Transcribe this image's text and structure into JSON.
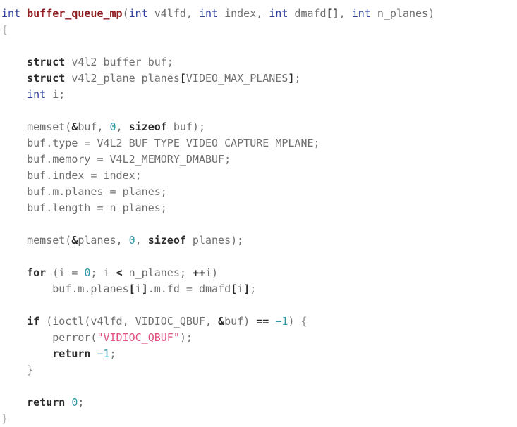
{
  "document": {
    "kind": "source-code-listing",
    "language": "c",
    "background": "#ffffff",
    "colors": {
      "plain": "#6f6f6f",
      "type_keyword": "#2f3f9e",
      "keyword": "#2b2b2b",
      "function_name": "#8f1d22",
      "number": "#2f97a6",
      "string": "#e0527f",
      "operator": "#2b2b2b",
      "brace": "#b0b0b0"
    }
  },
  "code": {
    "lines": [
      {
        "indent": 0,
        "tokens": [
          {
            "t": "int",
            "c": "t-type"
          },
          {
            "t": " ",
            "c": "t-plain"
          },
          {
            "t": "buffer_queue_mp",
            "c": "t-fn"
          },
          {
            "t": "(",
            "c": "t-plain"
          },
          {
            "t": "int",
            "c": "t-type"
          },
          {
            "t": " v4lfd, ",
            "c": "t-plain"
          },
          {
            "t": "int",
            "c": "t-type"
          },
          {
            "t": " index, ",
            "c": "t-plain"
          },
          {
            "t": "int",
            "c": "t-type"
          },
          {
            "t": " dmafd",
            "c": "t-plain"
          },
          {
            "t": "[]",
            "c": "t-op"
          },
          {
            "t": ", ",
            "c": "t-plain"
          },
          {
            "t": "int",
            "c": "t-type"
          },
          {
            "t": " n_planes)",
            "c": "t-plain"
          }
        ]
      },
      {
        "indent": 0,
        "tokens": [
          {
            "t": "{",
            "c": "t-brace"
          }
        ]
      },
      {
        "indent": 0,
        "tokens": [
          {
            "t": "",
            "c": "t-plain"
          }
        ]
      },
      {
        "indent": 1,
        "tokens": [
          {
            "t": "struct",
            "c": "t-kw"
          },
          {
            "t": " v4l2_buffer buf;",
            "c": "t-plain"
          }
        ]
      },
      {
        "indent": 1,
        "tokens": [
          {
            "t": "struct",
            "c": "t-kw"
          },
          {
            "t": " v4l2_plane planes",
            "c": "t-plain"
          },
          {
            "t": "[",
            "c": "t-op"
          },
          {
            "t": "VIDEO_MAX_PLANES",
            "c": "t-plain"
          },
          {
            "t": "]",
            "c": "t-op"
          },
          {
            "t": ";",
            "c": "t-plain"
          }
        ]
      },
      {
        "indent": 1,
        "tokens": [
          {
            "t": "int",
            "c": "t-type"
          },
          {
            "t": " i;",
            "c": "t-plain"
          }
        ]
      },
      {
        "indent": 0,
        "tokens": [
          {
            "t": "",
            "c": "t-plain"
          }
        ]
      },
      {
        "indent": 1,
        "tokens": [
          {
            "t": "memset(",
            "c": "t-plain"
          },
          {
            "t": "&",
            "c": "t-op"
          },
          {
            "t": "buf, ",
            "c": "t-plain"
          },
          {
            "t": "0",
            "c": "t-num"
          },
          {
            "t": ", ",
            "c": "t-plain"
          },
          {
            "t": "sizeof",
            "c": "t-kw"
          },
          {
            "t": " buf);",
            "c": "t-plain"
          }
        ]
      },
      {
        "indent": 1,
        "tokens": [
          {
            "t": "buf.type = V4L2_BUF_TYPE_VIDEO_CAPTURE_MPLANE;",
            "c": "t-plain"
          }
        ]
      },
      {
        "indent": 1,
        "tokens": [
          {
            "t": "buf.memory = V4L2_MEMORY_DMABUF;",
            "c": "t-plain"
          }
        ]
      },
      {
        "indent": 1,
        "tokens": [
          {
            "t": "buf.index = index;",
            "c": "t-plain"
          }
        ]
      },
      {
        "indent": 1,
        "tokens": [
          {
            "t": "buf.m.planes = planes;",
            "c": "t-plain"
          }
        ]
      },
      {
        "indent": 1,
        "tokens": [
          {
            "t": "buf.length = n_planes;",
            "c": "t-plain"
          }
        ]
      },
      {
        "indent": 0,
        "tokens": [
          {
            "t": "",
            "c": "t-plain"
          }
        ]
      },
      {
        "indent": 1,
        "tokens": [
          {
            "t": "memset(",
            "c": "t-plain"
          },
          {
            "t": "&",
            "c": "t-op"
          },
          {
            "t": "planes, ",
            "c": "t-plain"
          },
          {
            "t": "0",
            "c": "t-num"
          },
          {
            "t": ", ",
            "c": "t-plain"
          },
          {
            "t": "sizeof",
            "c": "t-kw"
          },
          {
            "t": " planes);",
            "c": "t-plain"
          }
        ]
      },
      {
        "indent": 0,
        "tokens": [
          {
            "t": "",
            "c": "t-plain"
          }
        ]
      },
      {
        "indent": 1,
        "tokens": [
          {
            "t": "for",
            "c": "t-kw"
          },
          {
            "t": " (i = ",
            "c": "t-plain"
          },
          {
            "t": "0",
            "c": "t-num"
          },
          {
            "t": "; i ",
            "c": "t-plain"
          },
          {
            "t": "<",
            "c": "t-op"
          },
          {
            "t": " n_planes; ",
            "c": "t-plain"
          },
          {
            "t": "++",
            "c": "t-op"
          },
          {
            "t": "i)",
            "c": "t-plain"
          }
        ]
      },
      {
        "indent": 2,
        "tokens": [
          {
            "t": "buf.m.planes",
            "c": "t-plain"
          },
          {
            "t": "[",
            "c": "t-op"
          },
          {
            "t": "i",
            "c": "t-plain"
          },
          {
            "t": "]",
            "c": "t-op"
          },
          {
            "t": ".m.fd = dmafd",
            "c": "t-plain"
          },
          {
            "t": "[",
            "c": "t-op"
          },
          {
            "t": "i",
            "c": "t-plain"
          },
          {
            "t": "]",
            "c": "t-op"
          },
          {
            "t": ";",
            "c": "t-plain"
          }
        ]
      },
      {
        "indent": 0,
        "tokens": [
          {
            "t": "",
            "c": "t-plain"
          }
        ]
      },
      {
        "indent": 1,
        "tokens": [
          {
            "t": "if",
            "c": "t-kw"
          },
          {
            "t": " (ioctl(v4lfd, VIDIOC_QBUF, ",
            "c": "t-plain"
          },
          {
            "t": "&",
            "c": "t-op"
          },
          {
            "t": "buf) ",
            "c": "t-plain"
          },
          {
            "t": "==",
            "c": "t-op"
          },
          {
            "t": " ",
            "c": "t-plain"
          },
          {
            "t": "−1",
            "c": "t-num"
          },
          {
            "t": ") ",
            "c": "t-plain"
          },
          {
            "t": "{",
            "c": "t-brace-d"
          }
        ]
      },
      {
        "indent": 2,
        "tokens": [
          {
            "t": "perror(",
            "c": "t-plain"
          },
          {
            "t": "\"VIDIOC_QBUF\"",
            "c": "t-str"
          },
          {
            "t": ");",
            "c": "t-plain"
          }
        ]
      },
      {
        "indent": 2,
        "tokens": [
          {
            "t": "return",
            "c": "t-kw"
          },
          {
            "t": " ",
            "c": "t-plain"
          },
          {
            "t": "−1",
            "c": "t-num"
          },
          {
            "t": ";",
            "c": "t-plain"
          }
        ]
      },
      {
        "indent": 1,
        "tokens": [
          {
            "t": "}",
            "c": "t-brace-d"
          }
        ]
      },
      {
        "indent": 0,
        "tokens": [
          {
            "t": "",
            "c": "t-plain"
          }
        ]
      },
      {
        "indent": 1,
        "tokens": [
          {
            "t": "return",
            "c": "t-kw"
          },
          {
            "t": " ",
            "c": "t-plain"
          },
          {
            "t": "0",
            "c": "t-num"
          },
          {
            "t": ";",
            "c": "t-plain"
          }
        ]
      },
      {
        "indent": 0,
        "tokens": [
          {
            "t": "}",
            "c": "t-brace"
          }
        ]
      }
    ]
  }
}
